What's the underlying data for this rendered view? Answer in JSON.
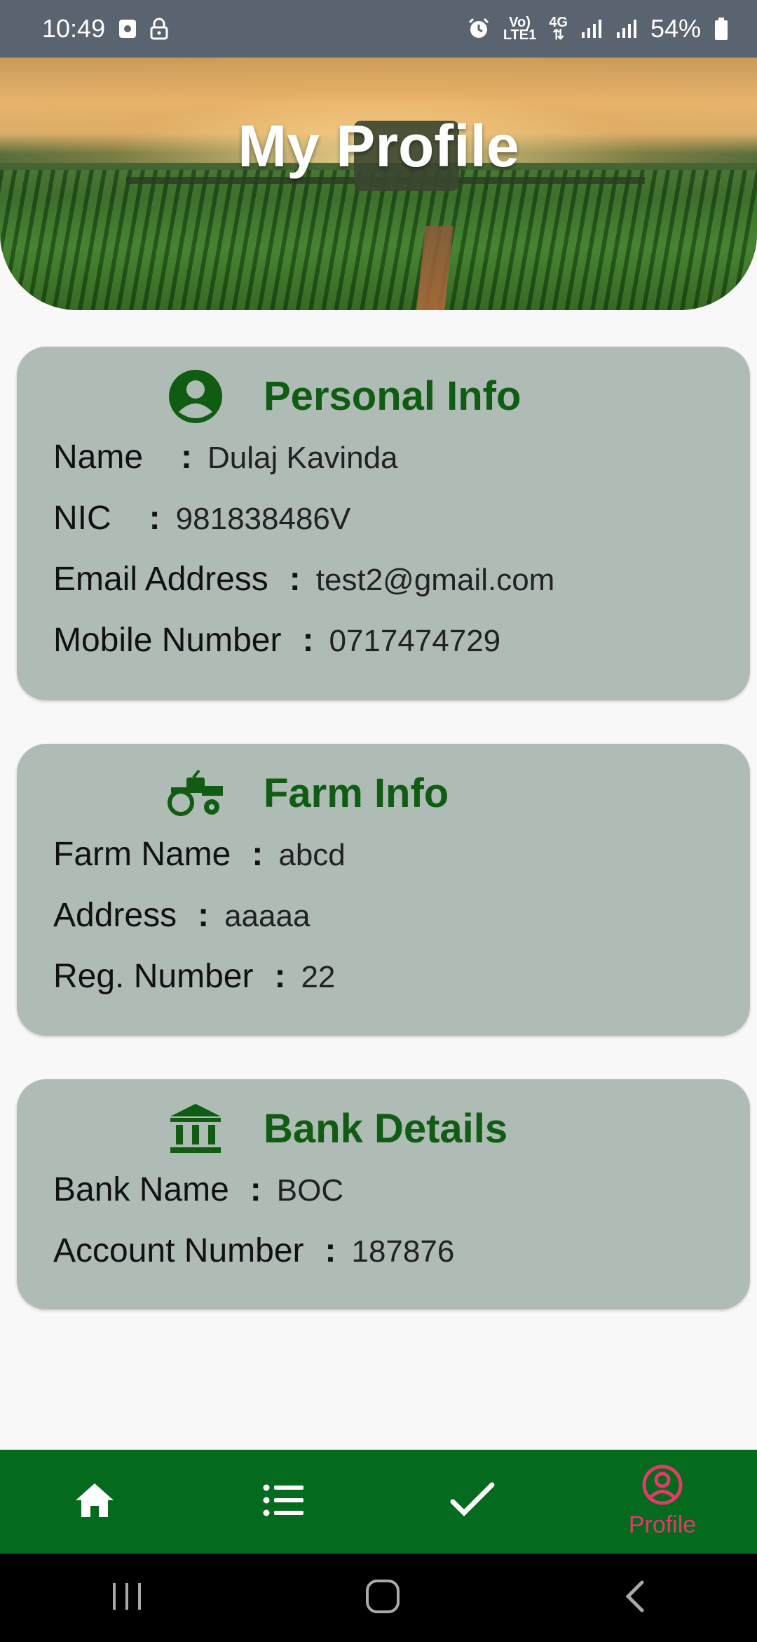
{
  "status_bar": {
    "time": "10:49",
    "network_top": "Vo)",
    "network_bottom": "LTE1",
    "net_type": "4G",
    "battery": "54%"
  },
  "header": {
    "title": "My Profile"
  },
  "personal_info": {
    "title": "Personal Info",
    "rows": [
      {
        "label": "Name",
        "value": "Dulaj Kavinda"
      },
      {
        "label": "NIC",
        "value": "981838486V"
      },
      {
        "label": "Email Address",
        "value": "test2@gmail.com"
      },
      {
        "label": "Mobile Number",
        "value": "0717474729"
      }
    ]
  },
  "farm_info": {
    "title": "Farm Info",
    "rows": [
      {
        "label": "Farm Name",
        "value": "abcd"
      },
      {
        "label": "Address",
        "value": "aaaaa"
      },
      {
        "label": "Reg. Number",
        "value": "22"
      }
    ]
  },
  "bank_details": {
    "title": "Bank Details",
    "rows": [
      {
        "label": "Bank Name",
        "value": "BOC"
      },
      {
        "label": "Account Number",
        "value": "187876"
      }
    ]
  },
  "colon": ":",
  "bottom_nav": {
    "active_label": "Profile",
    "icons": [
      "home-icon",
      "list-icon",
      "check-icon",
      "profile-icon"
    ],
    "active_color": "#e33a6a",
    "background": "#046a1d"
  },
  "colors": {
    "card_bg": "#aebcb5",
    "title_green": "#0f5c12"
  }
}
